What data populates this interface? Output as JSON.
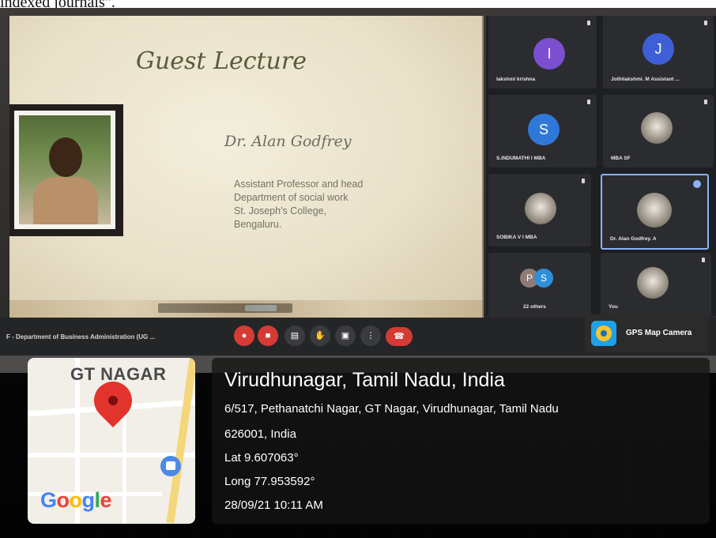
{
  "caption_cut": "indexed journals\".",
  "slide": {
    "title": "Guest Lecture",
    "speaker_name": "Dr. Alan Godfrey",
    "speaker_lines": [
      "Assistant Professor and head",
      "Department of social work",
      "St. Joseph's College,",
      "Bengaluru."
    ]
  },
  "participants": [
    {
      "initial": "I",
      "name": "lakshmi krishna",
      "color": "#7b4fd0"
    },
    {
      "initial": "J",
      "name": "Jothilakshmi. M Assistant ...",
      "color": "#3f5fd6"
    },
    {
      "initial": "S",
      "name": "S.INDUMATHI I MBA",
      "color": "#2f78d8"
    },
    {
      "initial": "",
      "name": "MBA SF",
      "color": ""
    },
    {
      "initial": "",
      "name": "SOBIKA V I MBA",
      "color": ""
    },
    {
      "initial": "",
      "name": "Dr. Alan Godfrey. A",
      "color": ""
    },
    {
      "initial": "",
      "name": "22 others",
      "color": ""
    },
    {
      "initial": "",
      "name": "You",
      "color": ""
    }
  ],
  "others_initials": [
    "P",
    "S"
  ],
  "meeting": {
    "title": "F - Department of Business Administration (UG ..."
  },
  "gps": {
    "app_name": "GPS Map Camera",
    "place": "Virudhunagar, Tamil Nadu, India",
    "address_line1": "6/517, Pethanatchi Nagar, GT Nagar, Virudhunagar, Tamil Nadu",
    "address_line2": "626001, India",
    "lat": "Lat 9.607063°",
    "long": "Long 77.953592°",
    "datetime": "28/09/21 10:11 AM",
    "map_label": "GT NAGAR",
    "google_letters": [
      {
        "ch": "G",
        "color": "#4285f4"
      },
      {
        "ch": "o",
        "color": "#ea4335"
      },
      {
        "ch": "o",
        "color": "#fbbc05"
      },
      {
        "ch": "g",
        "color": "#4285f4"
      },
      {
        "ch": "l",
        "color": "#34a853"
      },
      {
        "ch": "e",
        "color": "#ea4335"
      }
    ]
  }
}
